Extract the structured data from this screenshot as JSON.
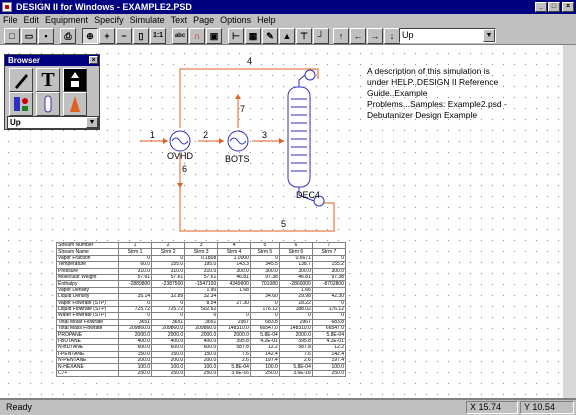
{
  "window": {
    "title": "DESIGN II for Windows - EXAMPLE2.PSD"
  },
  "menu": [
    "File",
    "Edit",
    "Equipment",
    "Specify",
    "Simulate",
    "Text",
    "Page",
    "Options",
    "Help"
  ],
  "toolbar": {
    "combo_value": "Up"
  },
  "browser": {
    "title": "Browser",
    "select_value": "Up"
  },
  "description": "A description of this simulation is under HELP..DESIGN II Reference Guide..Example Problems...Samples: Example2.psd - Debutanizer Design Example",
  "flowsheet": {
    "equipment": [
      {
        "label": "OVHD",
        "number": "6"
      },
      {
        "label": "BOTS",
        "number": "7"
      },
      {
        "label": "DEC4",
        "number": ""
      }
    ],
    "streams": [
      "1",
      "2",
      "3",
      "4",
      "5"
    ],
    "colors": {
      "stream": "#e06020",
      "equipment": "#3030c0",
      "label": "#000000"
    }
  },
  "table": {
    "header": [
      "Stream Number",
      "1",
      "2",
      "3",
      "4",
      "5",
      "6",
      "7"
    ],
    "rows": [
      [
        "Stream Name",
        "Strm 1",
        "Strm 2",
        "Strm 3",
        "Strm 4",
        "Strm 5",
        "Strm 6",
        "Strm 7"
      ],
      [
        "Vapor Fraction",
        "0",
        "0",
        "0.1808",
        "1.0000",
        "0",
        "0.6671",
        "0"
      ],
      [
        "Temperature",
        "60.0",
        "155.0",
        "195.0",
        "143.3",
        "345.5",
        "138.7",
        "155.2"
      ],
      [
        "Pressure",
        "310.0",
        "310.0",
        "310.0",
        "300.0",
        "300.0",
        "300.0",
        "300.0"
      ],
      [
        "Molecular Weight",
        "57.61",
        "57.61",
        "57.61",
        "46.81",
        "97.38",
        "46.81",
        "97.38"
      ],
      [
        "Enthalpy",
        "-2889800",
        "-2387500",
        "-1547100",
        "4349600",
        "701080",
        "-2860000",
        "-8702800"
      ],
      [
        "Vapor Density",
        "",
        "",
        "1.90",
        "1.68",
        "",
        "1.66",
        ""
      ],
      [
        "Liquid Density",
        "35.14",
        "32.89",
        "32.34",
        "",
        "34.60",
        "29.98",
        "42.30"
      ],
      [
        "Vapor Flowrate (STP)",
        "0",
        "0",
        "8.54",
        "27.30",
        "0",
        "18.22",
        "0"
      ],
      [
        "Liquid Flowrate (STP)",
        "725.72",
        "725.72",
        "502.62",
        "",
        "176.12",
        "188.02",
        "176.12"
      ],
      [
        "Water Flowrate (STP)",
        "0",
        "0",
        "0",
        "0",
        "0",
        "0",
        "0"
      ],
      [
        "Total Molar Flowrate",
        "3651",
        "3651",
        "3651",
        "2967",
        "683.8",
        "2967",
        "683.8"
      ],
      [
        "Total Mass Flowrate",
        "209860.0",
        "209860.0",
        "209860.0",
        "148310.0",
        "66547.0",
        "148310.0",
        "66547.0"
      ],
      [
        "PROPANE",
        "2000.0",
        "2000.0",
        "2000.0",
        "2000.0",
        "5.8E-04",
        "2000.0",
        "5.8E-04"
      ],
      [
        "I-BUTANE",
        "400.0",
        "400.0",
        "400.0",
        "395.8",
        "4.2E-01",
        "395.8",
        "4.2E-01"
      ],
      [
        "N-BUTANE",
        "600.0",
        "600.0",
        "600.0",
        "587.8",
        "12.2",
        "587.8",
        "12.2"
      ],
      [
        "I-PENTANE",
        "150.0",
        "150.0",
        "150.0",
        "7.6",
        "142.4",
        "7.6",
        "142.4"
      ],
      [
        "N-PENTANE",
        "200.0",
        "200.0",
        "200.0",
        "2.6",
        "197.4",
        "2.6",
        "197.4"
      ],
      [
        "N-HEXANE",
        "100.0",
        "100.0",
        "100.0",
        "5.8E-04",
        "100.0",
        "5.8E-04",
        "100.0"
      ],
      [
        "C7+",
        "250.0",
        "250.0",
        "250.0",
        "3.6E-16",
        "250.0",
        "3.6E-16",
        "250.0"
      ]
    ]
  },
  "status": {
    "text": "Ready",
    "x": "X 15.74",
    "y": "Y 10.54"
  }
}
